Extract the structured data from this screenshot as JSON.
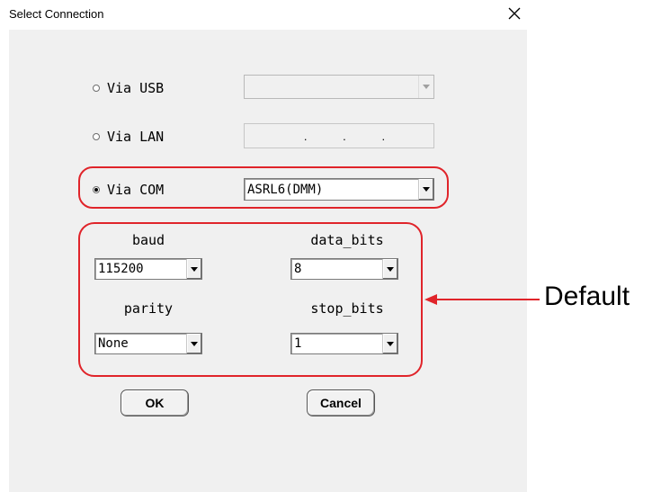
{
  "window": {
    "title": "Select Connection",
    "close_icon": "close-icon"
  },
  "connection": {
    "usb": {
      "label": "Via USB",
      "selected": false,
      "value": ""
    },
    "lan": {
      "label": "Via LAN",
      "selected": false,
      "ip_dots": [
        ".",
        ".",
        "."
      ]
    },
    "com": {
      "label": "Via COM",
      "selected": true,
      "value": "ASRL6(DMM)"
    }
  },
  "serial": {
    "baud": {
      "label": "baud",
      "value": "115200"
    },
    "data_bits": {
      "label": "data_bits",
      "value": "8"
    },
    "parity": {
      "label": "parity",
      "value": "None"
    },
    "stop_bits": {
      "label": "stop_bits",
      "value": "1"
    }
  },
  "buttons": {
    "ok": "OK",
    "cancel": "Cancel"
  },
  "annotation": {
    "text": "Default",
    "color": "#e0242a"
  }
}
